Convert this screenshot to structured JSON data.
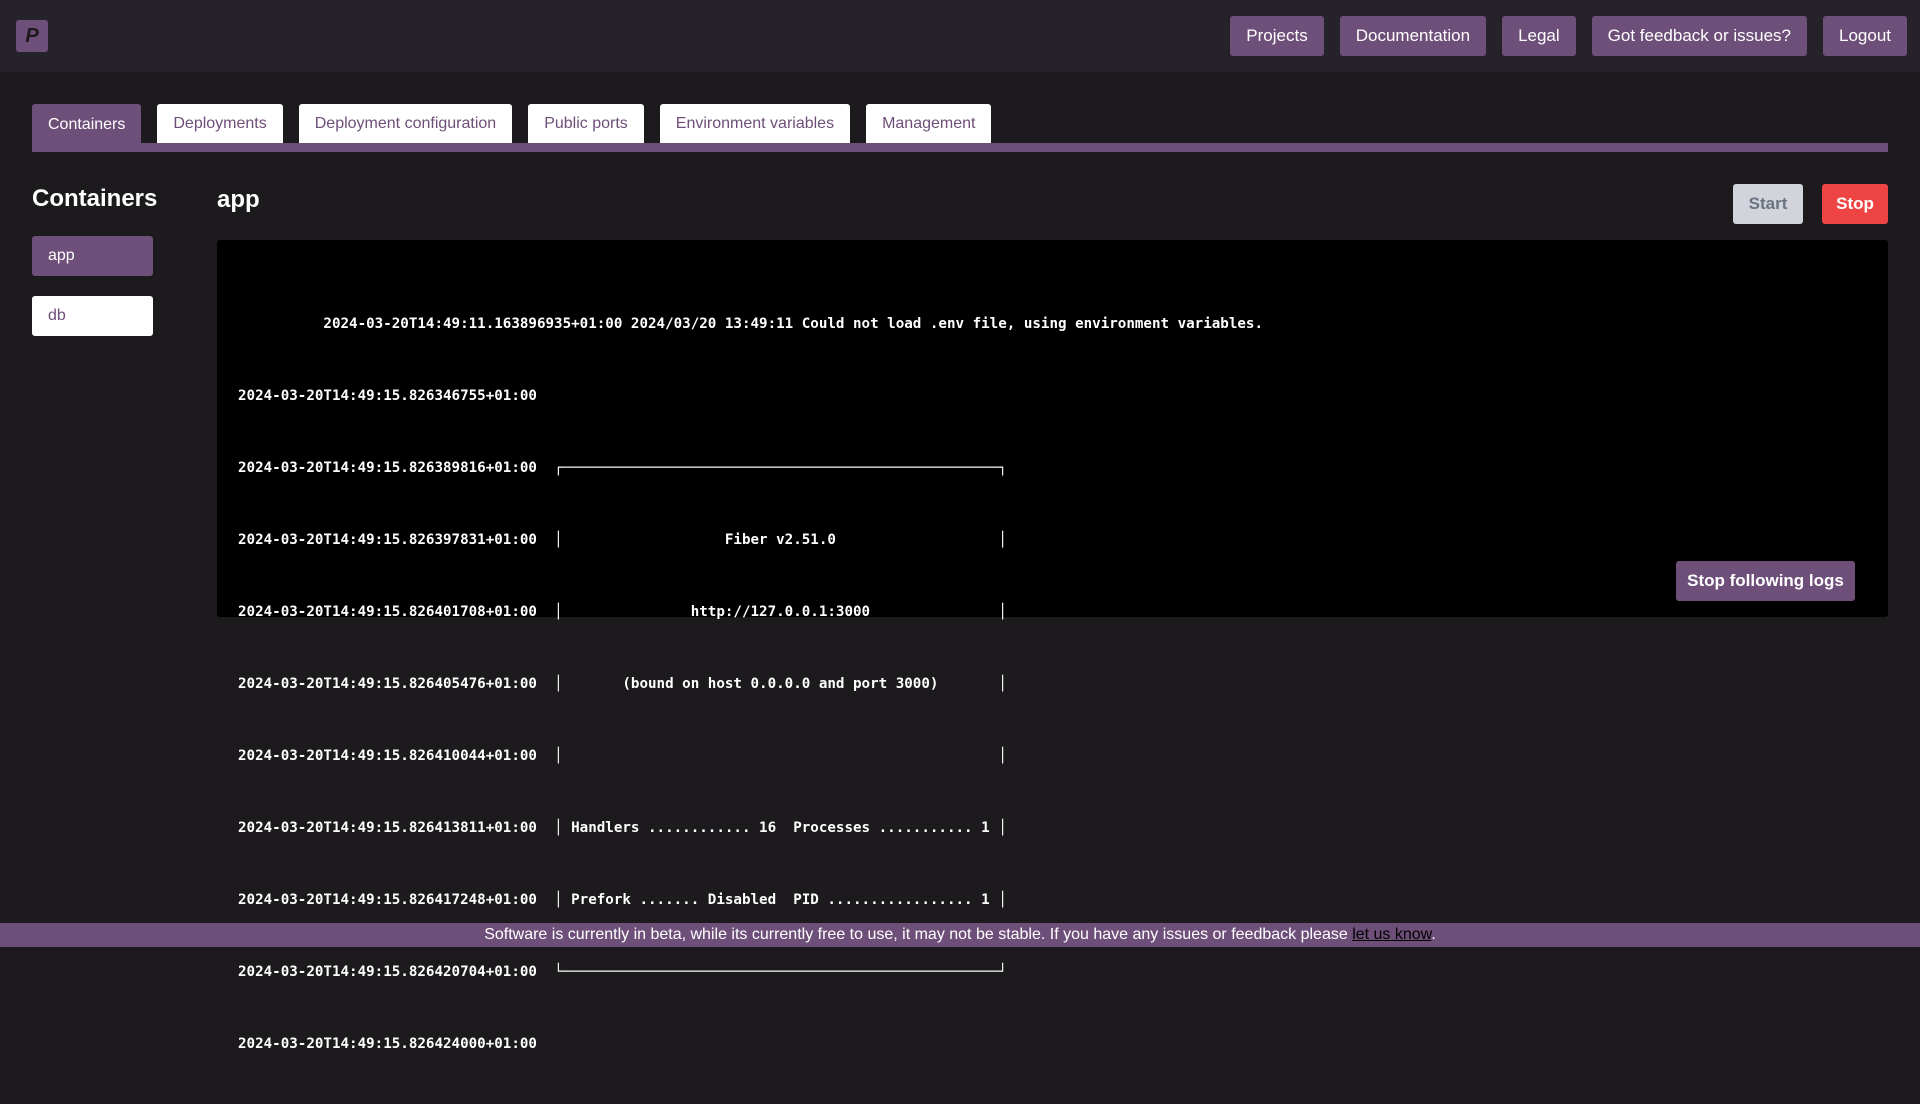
{
  "app": {
    "logo_letter": "P"
  },
  "nav": {
    "items": [
      {
        "label": "Projects"
      },
      {
        "label": "Documentation"
      },
      {
        "label": "Legal"
      },
      {
        "label": "Got feedback or issues?"
      },
      {
        "label": "Logout"
      }
    ]
  },
  "tabs": {
    "items": [
      {
        "label": "Containers",
        "active": true
      },
      {
        "label": "Deployments",
        "active": false
      },
      {
        "label": "Deployment configuration",
        "active": false
      },
      {
        "label": "Public ports",
        "active": false
      },
      {
        "label": "Environment variables",
        "active": false
      },
      {
        "label": "Management",
        "active": false
      }
    ]
  },
  "sidebar": {
    "title": "Containers",
    "items": [
      {
        "label": "app",
        "active": true
      },
      {
        "label": "db",
        "active": false
      }
    ]
  },
  "main": {
    "container_name": "app",
    "start_label": "Start",
    "stop_label": "Stop",
    "follow_logs_label": "Stop following logs"
  },
  "logs": {
    "lines": [
      "          2024-03-20T14:49:11.163896935+01:00 2024/03/20 13:49:11 Could not load .env file, using environment variables.",
      "2024-03-20T14:49:15.826346755+01:00",
      "2024-03-20T14:49:15.826389816+01:00  ┌───────────────────────────────────────────────────┐",
      "2024-03-20T14:49:15.826397831+01:00  │                   Fiber v2.51.0                   │",
      "2024-03-20T14:49:15.826401708+01:00  │               http://127.0.0.1:3000               │",
      "2024-03-20T14:49:15.826405476+01:00  │       (bound on host 0.0.0.0 and port 3000)       │",
      "2024-03-20T14:49:15.826410044+01:00  │                                                   │",
      "2024-03-20T14:49:15.826413811+01:00  │ Handlers ............ 16  Processes ........... 1 │",
      "2024-03-20T14:49:15.826417248+01:00  │ Prefork ....... Disabled  PID ................. 1 │",
      "2024-03-20T14:49:15.826420704+01:00  └───────────────────────────────────────────────────┘",
      "2024-03-20T14:49:15.826424000+01:00"
    ]
  },
  "beta_banner": {
    "text": "Software is currently in beta, while its currently free to use, it may not be stable. If you have any issues or feedback please ",
    "link_label": "let us know",
    "suffix": "."
  },
  "colors": {
    "accent": "#6e4f79",
    "background": "#1c1a1d",
    "topbar": "#25222a",
    "danger": "#ef4444",
    "log_background": "#000000"
  }
}
